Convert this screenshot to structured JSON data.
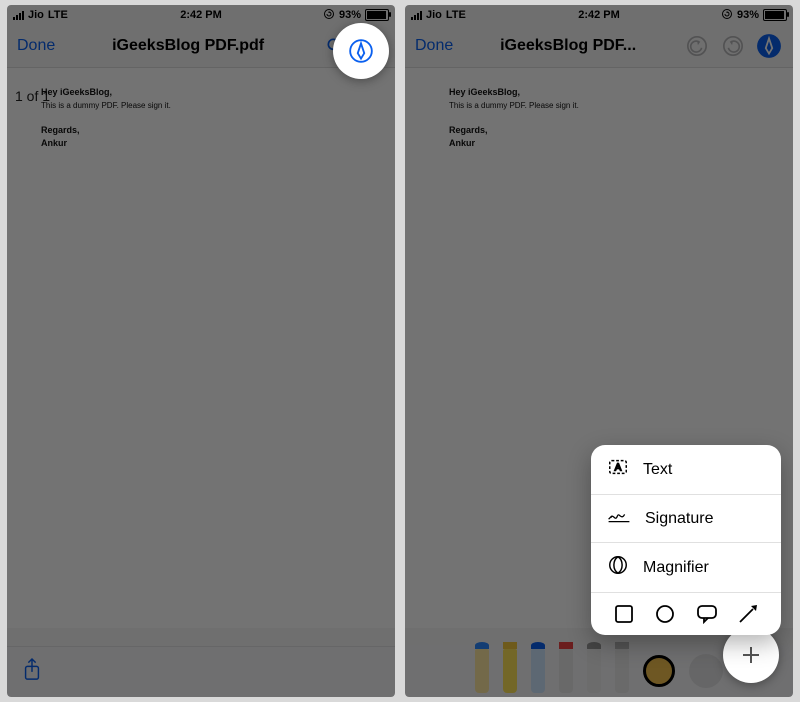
{
  "status": {
    "carrier": "Jio",
    "network": "LTE",
    "time": "2:42 PM",
    "battery_pct": "93%"
  },
  "left": {
    "done": "Done",
    "title": "iGeeksBlog PDF.pdf",
    "page_of": "1 of 1",
    "doc": {
      "greeting": "Hey iGeeksBlog,",
      "body": "This is a dummy PDF. Please sign it.",
      "regards": "Regards,",
      "sender": "Ankur"
    }
  },
  "right": {
    "done": "Done",
    "title": "iGeeksBlog PDF...",
    "doc": {
      "greeting": "Hey iGeeksBlog,",
      "body": "This is a dummy PDF. Please sign it.",
      "regards": "Regards,",
      "sender": "Ankur"
    },
    "popup": {
      "text": "Text",
      "signature": "Signature",
      "magnifier": "Magnifier"
    }
  },
  "icons": {
    "search": "search-icon",
    "markup": "markup-pen-icon",
    "undo": "undo-icon",
    "redo": "redo-icon",
    "share": "share-icon",
    "plus": "plus-icon",
    "text": "text-box-icon",
    "signature": "signature-icon",
    "magnifier": "magnifier-icon",
    "square": "square-shape-icon",
    "circle": "circle-shape-icon",
    "speech": "speech-bubble-icon",
    "arrow": "arrow-shape-icon",
    "rotation": "rotation-lock-icon"
  }
}
